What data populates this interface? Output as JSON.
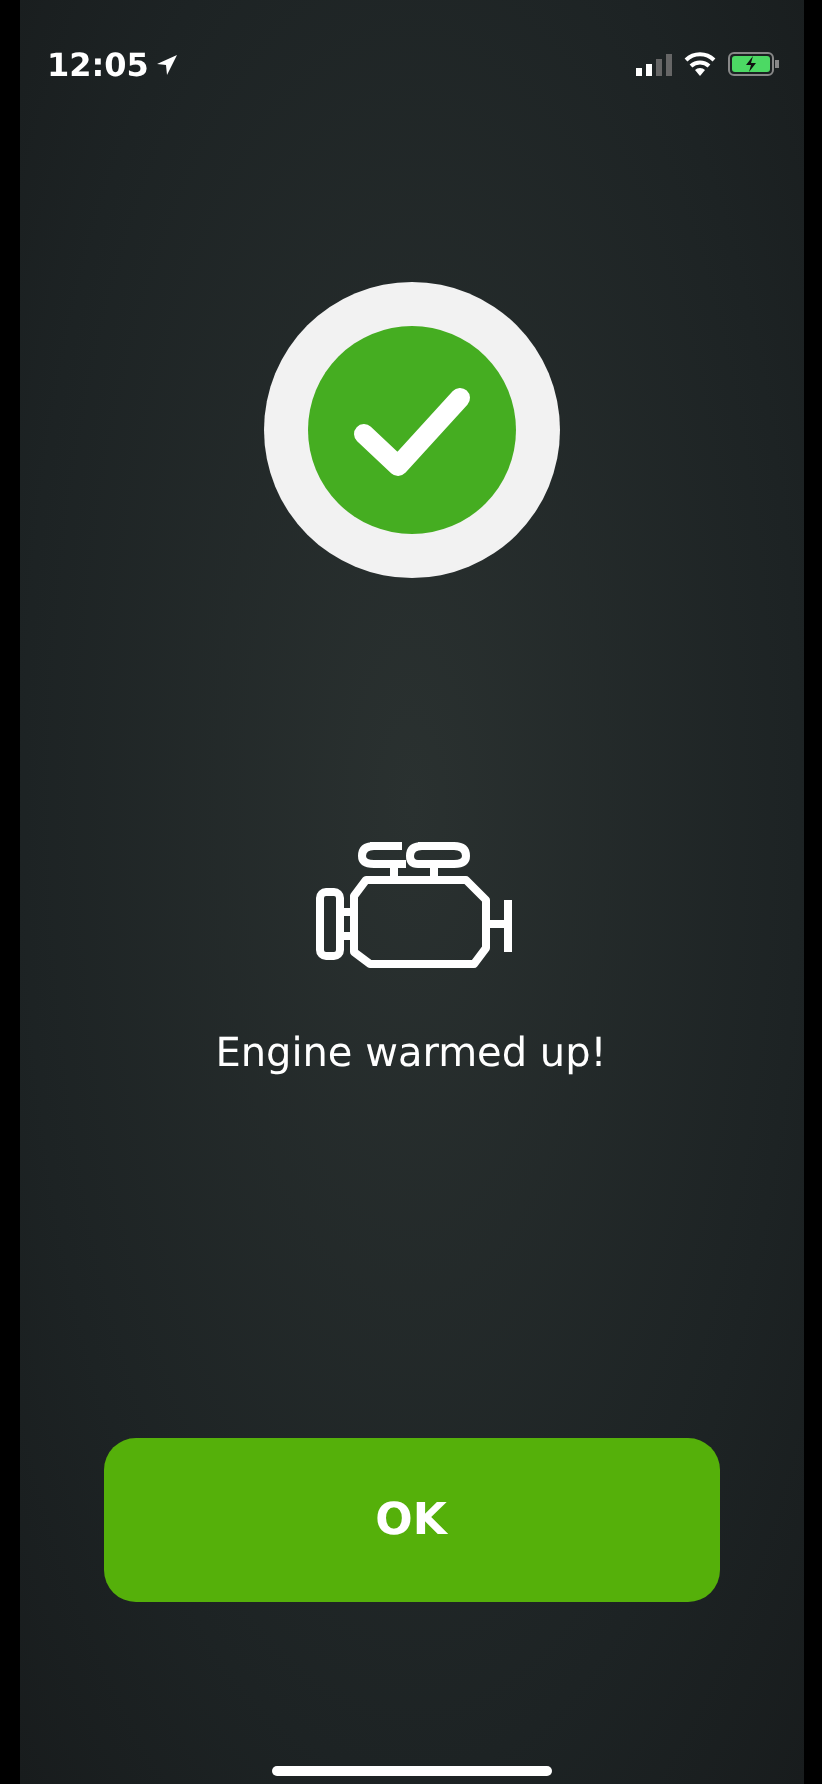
{
  "status_bar": {
    "time": "12:05"
  },
  "message": "Engine warmed up!",
  "buttons": [
    "OK"
  ]
}
